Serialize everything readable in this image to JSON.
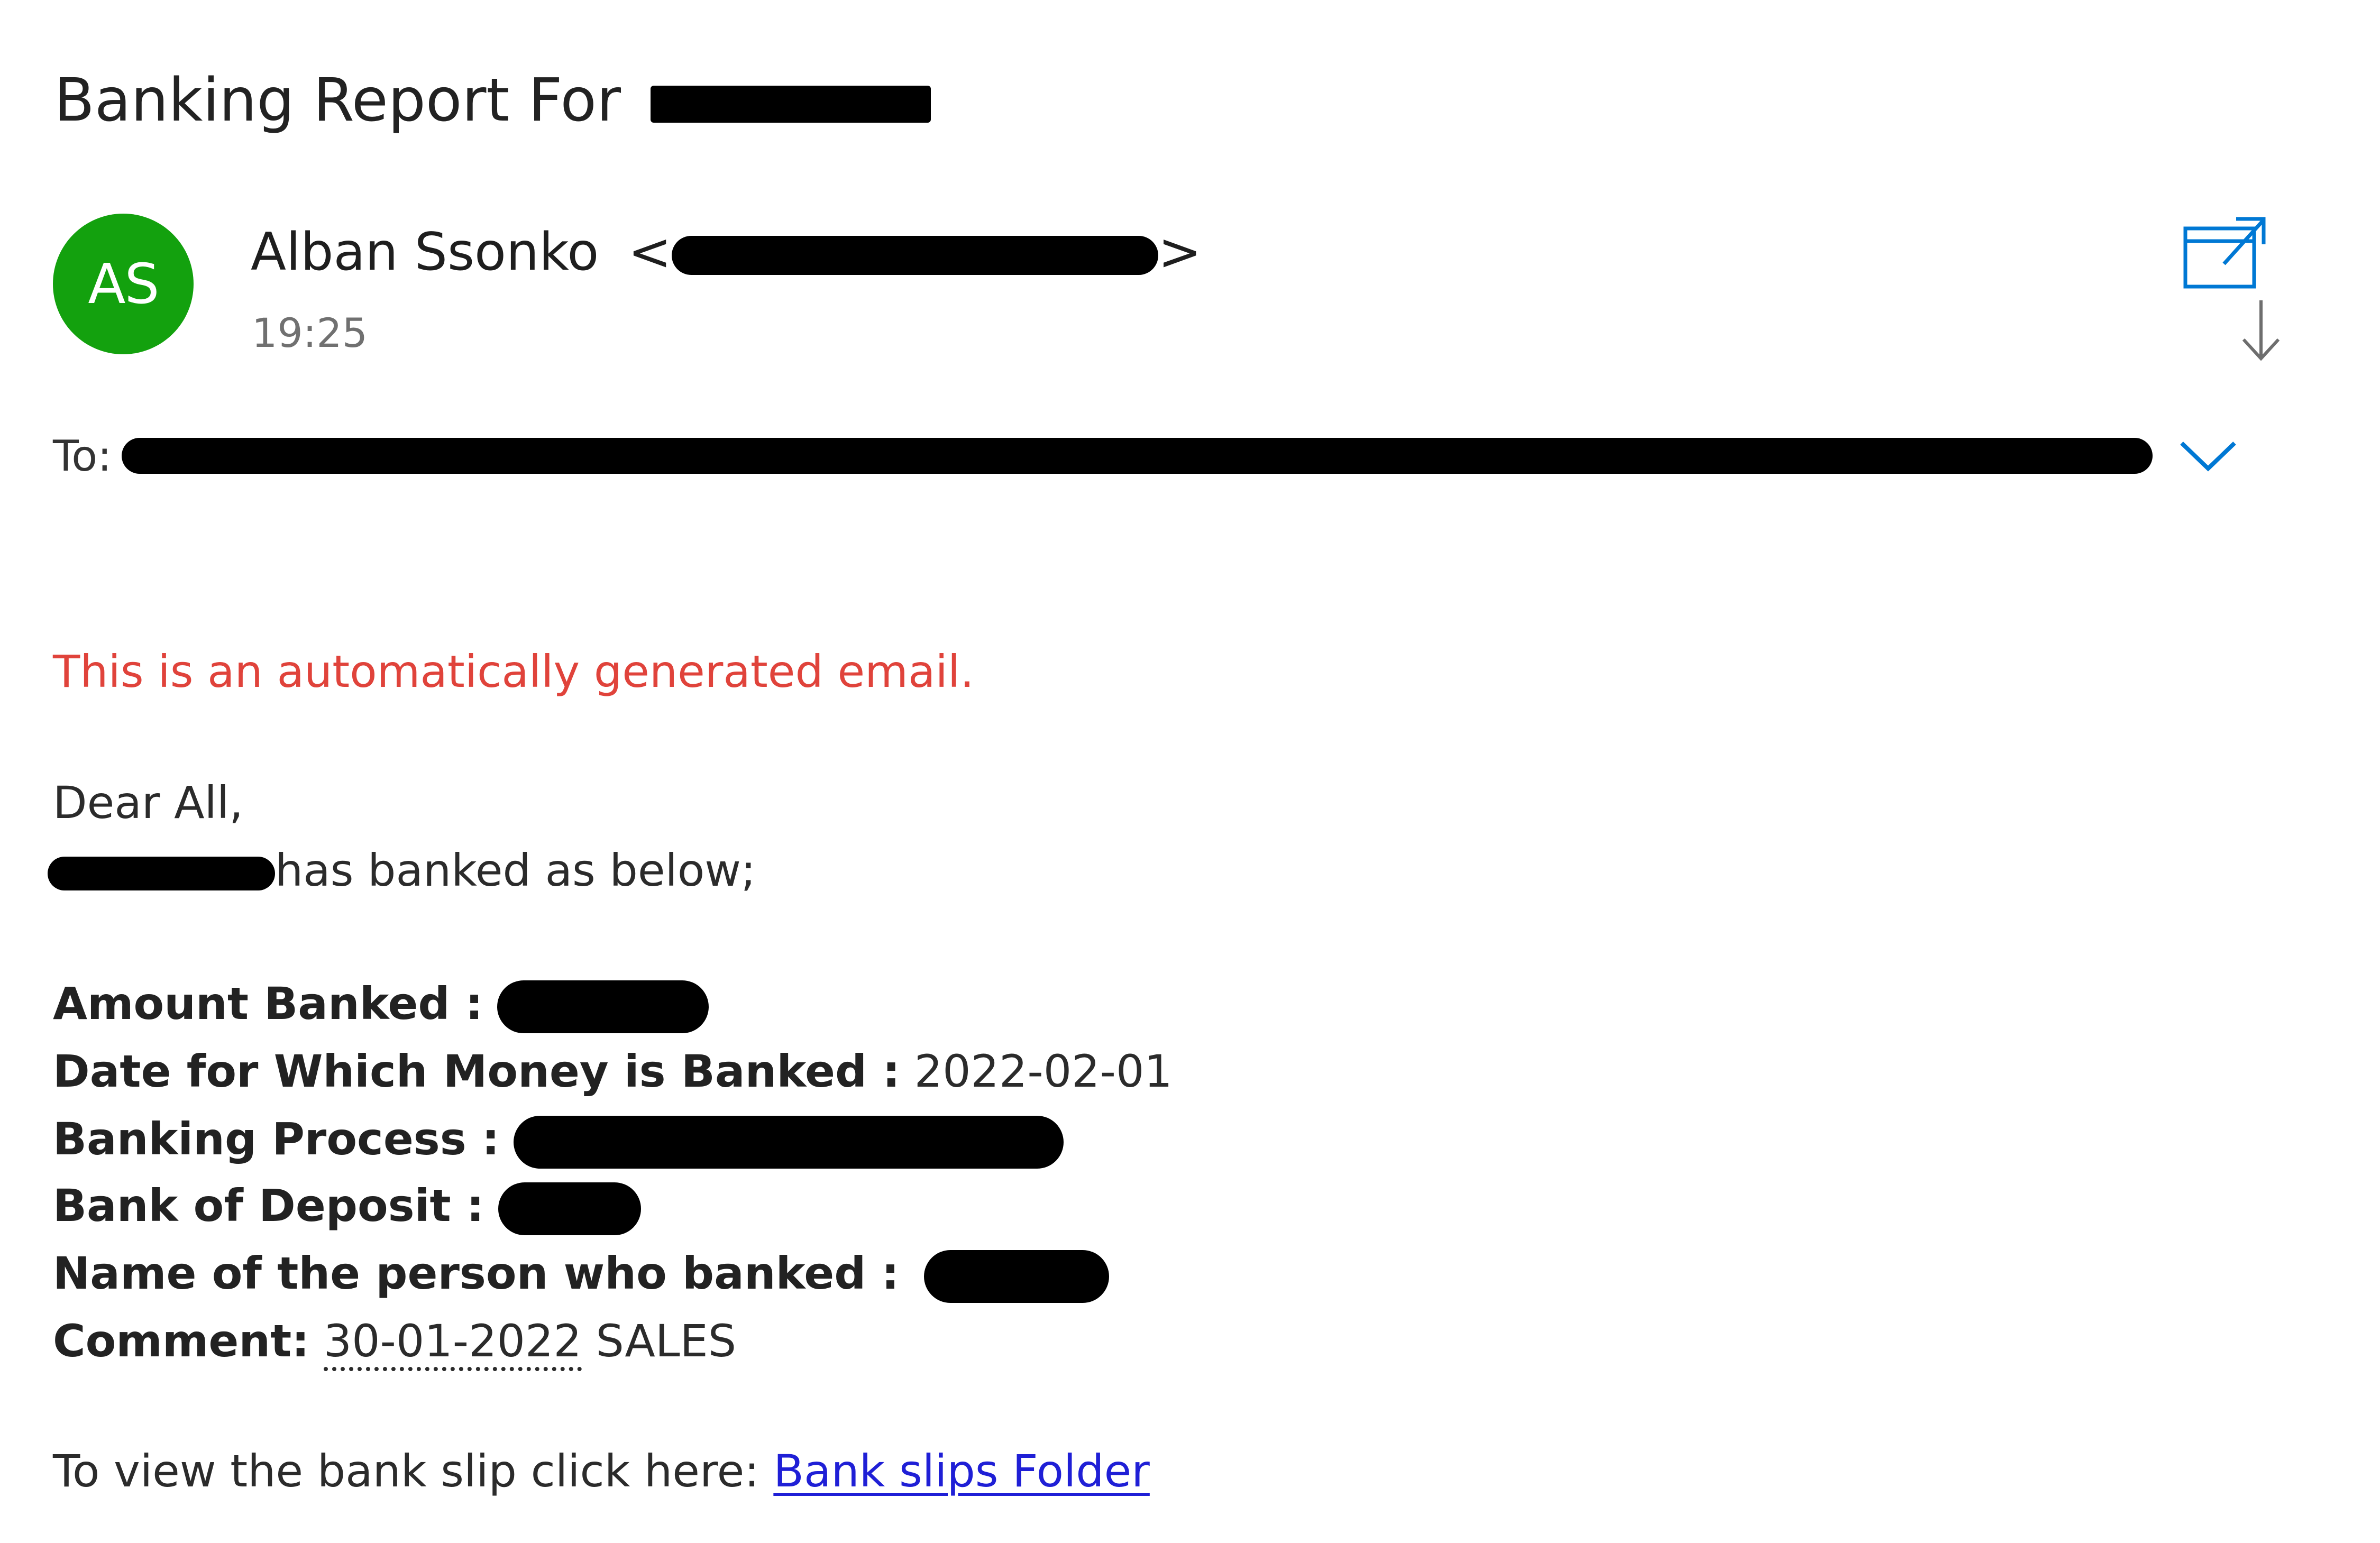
{
  "email": {
    "subject": "Banking Report For",
    "sender": {
      "avatar_initials": "AS",
      "avatar_color": "#13a10e",
      "name": "Alban Ssonko",
      "email_open": "<",
      "email_close": ">"
    },
    "time": "19:25",
    "to_label": "To:",
    "auto_notice": "This is an automatically generated email.",
    "greeting": "Dear All,",
    "intro_suffix": "has banked as below;",
    "fields": {
      "amount_label": "Amount Banked :",
      "date_label": "Date for Which Money is Banked :",
      "date_value": "2022-02-01",
      "process_label": "Banking Process :",
      "bank_label": "Bank of Deposit :",
      "person_label": "Name of the person who banked :",
      "comment_label": "Comment:",
      "comment_date": "30-01-2022",
      "comment_text": "SALES"
    },
    "slip_text": "To view the bank slip click here:",
    "slip_link": "Bank slips Folder"
  },
  "colors": {
    "accent": "#0078d4",
    "notice": "#e0433b",
    "link": "#1f1fd6",
    "redaction": "#000000"
  },
  "icons": {
    "popout": "open-in-new-window-icon",
    "download": "download-arrow-icon",
    "expand": "chevron-down-icon"
  }
}
